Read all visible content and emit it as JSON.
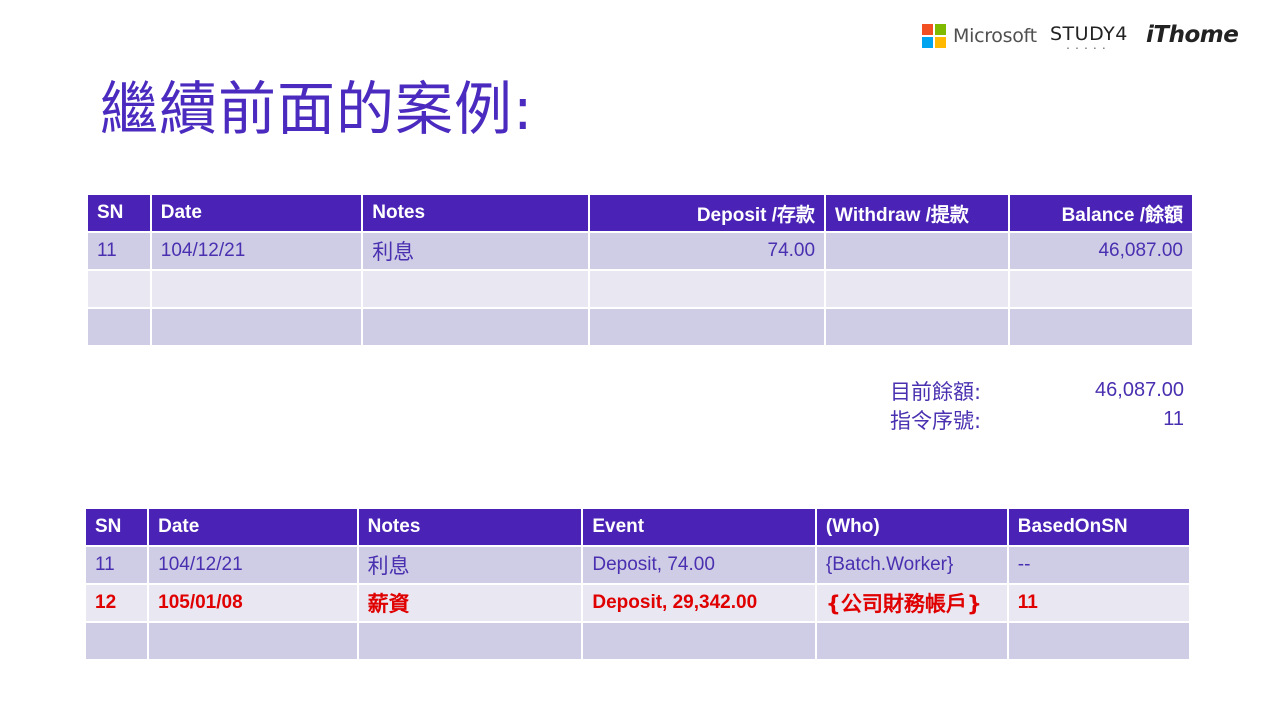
{
  "logos": {
    "microsoft": "Microsoft",
    "study4": "STUDY4",
    "ithome": "iThome",
    "microsoft_colors": [
      "#f25022",
      "#7fba00",
      "#00a4ef",
      "#ffb900"
    ]
  },
  "title": "繼續前面的案例:",
  "table1": {
    "headers": [
      "SN",
      "Date",
      "Notes",
      "Deposit /存款",
      "Withdraw /提款",
      "Balance /餘額"
    ],
    "rows": [
      [
        "11",
        "104/12/21",
        "利息",
        "74.00",
        "",
        "46,087.00"
      ],
      [
        "",
        "",
        "",
        "",
        "",
        ""
      ],
      [
        "",
        "",
        "",
        "",
        "",
        ""
      ]
    ]
  },
  "summary": {
    "balance_label": "目前餘額:",
    "balance_value": "46,087.00",
    "sn_label": "指令序號:",
    "sn_value": "11"
  },
  "table2": {
    "headers": [
      "SN",
      "Date",
      "Notes",
      "Event",
      "(Who)",
      "BasedOnSN"
    ],
    "rows": [
      [
        "11",
        "104/12/21",
        "利息",
        "Deposit, 74.00",
        "{Batch.Worker}",
        "--"
      ],
      [
        "12",
        "105/01/08",
        "薪資",
        "Deposit, 29,342.00",
        "{公司財務帳戶}",
        "11"
      ],
      [
        "",
        "",
        "",
        "",
        "",
        ""
      ]
    ]
  },
  "colors": {
    "header_bg": "#4a23b6",
    "row_dark": "#cfcde6",
    "row_light": "#e8e7f2",
    "text": "#4a30b0",
    "highlight": "#e00000",
    "title": "#4b2bbf"
  }
}
